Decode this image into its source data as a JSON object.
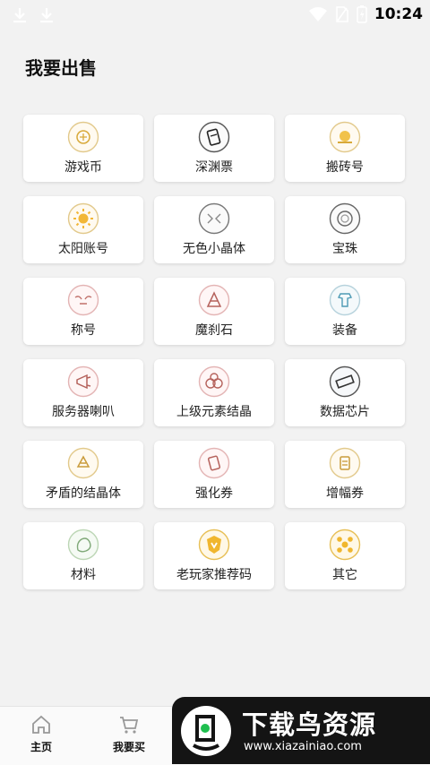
{
  "statusbar": {
    "time": "10:24"
  },
  "page": {
    "title": "我要出售"
  },
  "categories": [
    {
      "label": "游戏币",
      "icon": "coin-icon"
    },
    {
      "label": "深渊票",
      "icon": "ticket-icon"
    },
    {
      "label": "搬砖号",
      "icon": "gold-bars-icon"
    },
    {
      "label": "太阳账号",
      "icon": "sun-icon"
    },
    {
      "label": "无色小晶体",
      "icon": "crystal-icon"
    },
    {
      "label": "宝珠",
      "icon": "orb-icon"
    },
    {
      "label": "称号",
      "icon": "title-icon"
    },
    {
      "label": "魔刹石",
      "icon": "demon-stone-icon"
    },
    {
      "label": "装备",
      "icon": "equipment-icon"
    },
    {
      "label": "服务器喇叭",
      "icon": "megaphone-icon"
    },
    {
      "label": "上级元素结晶",
      "icon": "element-crystal-icon"
    },
    {
      "label": "数据芯片",
      "icon": "chip-icon"
    },
    {
      "label": "矛盾的结晶体",
      "icon": "contradiction-crystal-icon"
    },
    {
      "label": "强化券",
      "icon": "enhance-coupon-icon"
    },
    {
      "label": "增幅券",
      "icon": "amplify-coupon-icon"
    },
    {
      "label": "材料",
      "icon": "material-icon"
    },
    {
      "label": "老玩家推荐码",
      "icon": "veteran-code-icon"
    },
    {
      "label": "其它",
      "icon": "other-icon"
    }
  ],
  "tabbar": {
    "home_label": "主页",
    "buy_label": "我要买"
  },
  "watermark": {
    "title": "下载鸟资源",
    "url": "www.xiazainiao.com"
  },
  "colors": {
    "background": "#f2f2f2",
    "card": "#ffffff",
    "accent_gold": "#d8a93a",
    "watermark_bg": "#141414",
    "watermark_green": "#1fbf4f"
  }
}
